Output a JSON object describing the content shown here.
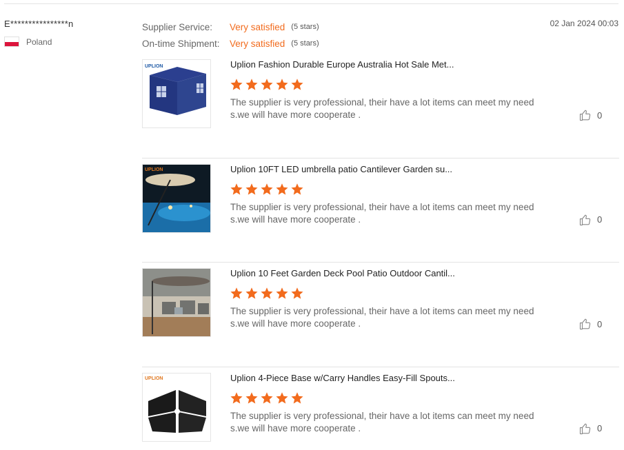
{
  "buyer": {
    "name": "E****************n",
    "country": "Poland",
    "flag_colors": [
      "#ffffff",
      "#dc143c"
    ]
  },
  "ratings": [
    {
      "label": "Supplier Service:",
      "value": "Very satisfied",
      "stars_text": "(5 stars)"
    },
    {
      "label": "On-time Shipment:",
      "value": "Very satisfied",
      "stars_text": "(5 stars)"
    }
  ],
  "date": "02 Jan 2024 00:03",
  "colors": {
    "accent": "#f26b1d",
    "star": "#f26b1d",
    "divider": "#e3e3e3"
  },
  "reviews": [
    {
      "title": "Uplion Fashion Durable Europe Australia Hot Sale Met...",
      "rating": 5,
      "comment": "The supplier is very professional, their have a lot items can meet my need s.we will have more cooperate .",
      "likes": "0",
      "thumb_brand": "UPLION",
      "thumb_subject": "blue gazebo tent"
    },
    {
      "title": "Uplion 10FT LED umbrella patio Cantilever Garden su...",
      "rating": 5,
      "comment": "The supplier is very professional, their have a lot items can meet my need s.we will have more cooperate .",
      "likes": "0",
      "thumb_brand": "UPLION",
      "thumb_subject": "LED cantilever umbrella by pool at night"
    },
    {
      "title": "Uplion 10 Feet Garden Deck Pool Patio Outdoor Cantil...",
      "rating": 5,
      "comment": "The supplier is very professional, their have a lot items can meet my need s.we will have more cooperate .",
      "likes": "0",
      "thumb_brand": "",
      "thumb_subject": "cantilever umbrella over patio furniture"
    },
    {
      "title": "Uplion 4-Piece Base w/Carry Handles Easy-Fill Spouts...",
      "rating": 5,
      "comment": "The supplier is very professional, their have a lot items can meet my need s.we will have more cooperate .",
      "likes": "0",
      "thumb_brand": "UPLION",
      "thumb_subject": "black 4-piece umbrella base"
    }
  ]
}
